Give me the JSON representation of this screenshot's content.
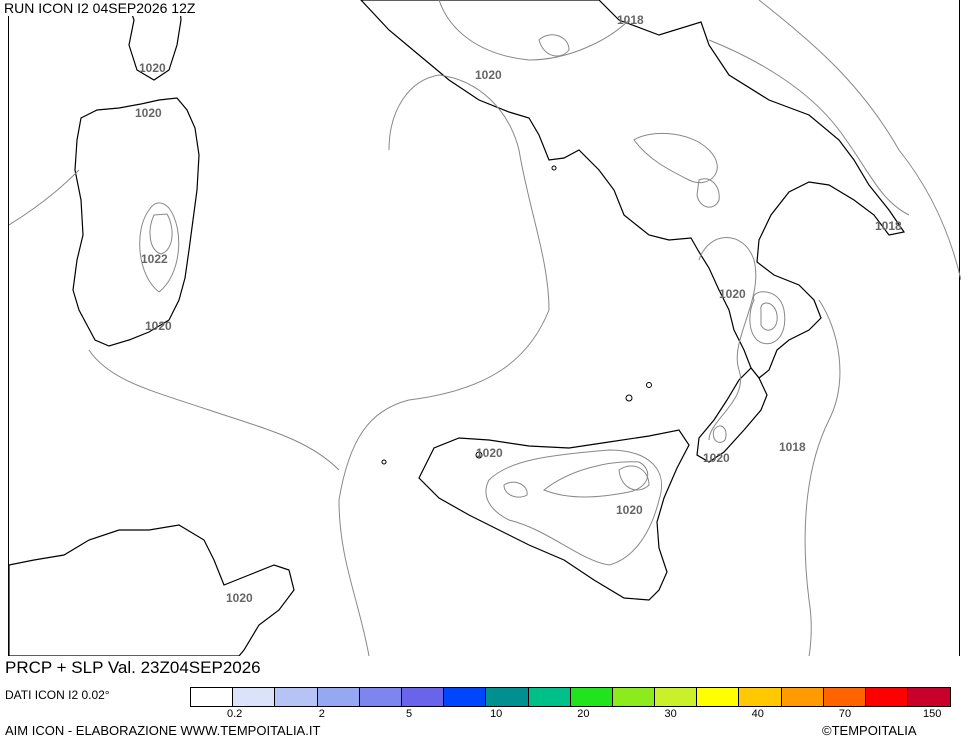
{
  "header": {
    "run_title": "RUN ICON I2 04SEP2026 12Z"
  },
  "map": {
    "isobar_labels": [
      "1018",
      "1020",
      "1020",
      "1020",
      "1022",
      "1020",
      "1018",
      "1020",
      "1020",
      "1018",
      "1020",
      "1020",
      "1020"
    ],
    "land_color": "#ffffff",
    "coast_color": "#000000",
    "isobar_color": "#777777"
  },
  "footer": {
    "valid_title": "PRCP + SLP Val. 23Z04SEP2026",
    "data_resolution": "DATI ICON I2 0.02°",
    "elaboration": "AIM ICON - ELABORAZIONE WWW.TEMPOITALIA.IT",
    "copyright": "©TEMPOITALIA"
  },
  "legend": {
    "colors": [
      "#ffffff",
      "#dbe3fb",
      "#b6c4f5",
      "#96a8f1",
      "#7d86ee",
      "#6a64ea",
      "#0046ff",
      "#009090",
      "#00c08a",
      "#22e41c",
      "#8ceb1c",
      "#c9f02a",
      "#ffff00",
      "#ffc800",
      "#ff9b00",
      "#ff6400",
      "#ff0000",
      "#c8002a"
    ],
    "tick_labels": [
      "0.2",
      "2",
      "5",
      "10",
      "20",
      "30",
      "40",
      "70",
      "150"
    ]
  }
}
